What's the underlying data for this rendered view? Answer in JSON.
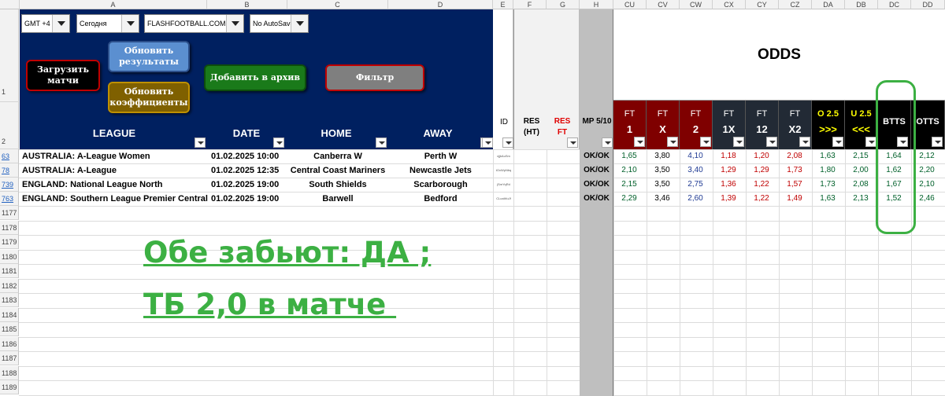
{
  "col_headers": [
    "A",
    "B",
    "C",
    "D",
    "E",
    "F",
    "G",
    "H",
    "CU",
    "CV",
    "CW",
    "CX",
    "CY",
    "CZ",
    "DA",
    "DB",
    "DC",
    "DD"
  ],
  "row_headers": {
    "r1": "1",
    "r2": "2",
    "data": [
      "63",
      "78",
      "739",
      "763"
    ],
    "empty": [
      "1177",
      "1178",
      "1179",
      "1180",
      "1181",
      "1182",
      "1183",
      "1184",
      "1185",
      "1186",
      "1187",
      "1188",
      "1189"
    ]
  },
  "controls": {
    "timezone": "GMT +4",
    "day": "Сегодня",
    "source": "FLASHFOOTBALL.COM (EN)",
    "autosave": "No AutoSave",
    "btn_load": "Загрузить матчи",
    "btn_update_results": "Обновить результаты",
    "btn_update_odds": "Обновить коэффициенты",
    "btn_archive": "Добавить в архив",
    "btn_filter": "Фильтр"
  },
  "headers": {
    "league": "LEAGUE",
    "date": "DATE",
    "home": "HOME",
    "away": "AWAY",
    "id": "ID",
    "res_ht": "RES (HT)",
    "res_ft": "RES FT",
    "mp": "MP 5/10",
    "odds": "ODDS"
  },
  "odds_cols": [
    {
      "top": "FT",
      "bot": "1",
      "bg": "#7f0000",
      "fg": "#ffffff"
    },
    {
      "top": "FT",
      "bot": "X",
      "bg": "#7f0000",
      "fg": "#ffffff"
    },
    {
      "top": "FT",
      "bot": "2",
      "bg": "#7f0000",
      "fg": "#ffffff"
    },
    {
      "top": "FT",
      "bot": "1X",
      "bg": "#222a35",
      "fg": "#ffffff"
    },
    {
      "top": "FT",
      "bot": "12",
      "bg": "#222a35",
      "fg": "#ffffff"
    },
    {
      "top": "FT",
      "bot": "X2",
      "bg": "#222a35",
      "fg": "#ffffff"
    },
    {
      "top": "O 2.5",
      "bot": ">>>",
      "bg": "#000000",
      "fg": "#ffff00"
    },
    {
      "top": "U 2.5",
      "bot": "<<<",
      "bg": "#000000",
      "fg": "#ffff00"
    },
    {
      "top": "BTTS",
      "bot": "",
      "bg": "#000000",
      "fg": "#ffffff"
    },
    {
      "top": "OTTS",
      "bot": "",
      "bg": "#000000",
      "fg": "#ffffff"
    }
  ],
  "matches": [
    {
      "league": "AUSTRALIA: A-League Women",
      "date": "01.02.2025 10:00",
      "home": "Canberra W",
      "away": "Perth W",
      "id": "xjjkAuSm",
      "mp": "OK/OK",
      "odds": [
        "1,65",
        "3,80",
        "4,10",
        "1,18",
        "1,20",
        "2,08",
        "1,63",
        "2,15",
        "1,64",
        "2,12"
      ]
    },
    {
      "league": "AUSTRALIA: A-League",
      "date": "01.02.2025 12:35",
      "home": "Central Coast Mariners",
      "away": "Newcastle Jets",
      "id": "tOxWpNbq",
      "mp": "OK/OK",
      "odds": [
        "2,10",
        "3,50",
        "3,40",
        "1,29",
        "1,29",
        "1,73",
        "1,80",
        "2,00",
        "1,62",
        "2,20"
      ]
    },
    {
      "league": "ENGLAND: National League North",
      "date": "01.02.2025 19:00",
      "home": "South Shields",
      "away": "Scarborough",
      "id": "jSreYqRd",
      "mp": "OK/OK",
      "odds": [
        "2,15",
        "3,50",
        "2,75",
        "1,36",
        "1,22",
        "1,57",
        "1,73",
        "2,08",
        "1,67",
        "2,10"
      ]
    },
    {
      "league": "ENGLAND: Southern League Premier Central",
      "date": "01.02.2025 19:00",
      "home": "Barwell",
      "away": "Bedford",
      "id": "CLoaWuJf",
      "mp": "OK/OK",
      "odds": [
        "2,29",
        "3,46",
        "2,60",
        "1,39",
        "1,22",
        "1,49",
        "1,63",
        "2,13",
        "1,52",
        "2,46"
      ]
    }
  ],
  "odds_colors": [
    "#00602a",
    "#000000",
    "#1f3a93",
    "#c00000",
    "#c00000",
    "#c00000",
    "#00602a",
    "#00602a",
    "#00602a",
    "#00602a"
  ],
  "annotation": {
    "line1": "Обе забьют: ДА ;",
    "line2": "ТБ 2,0 в матче ",
    "color": "#3cb043"
  }
}
